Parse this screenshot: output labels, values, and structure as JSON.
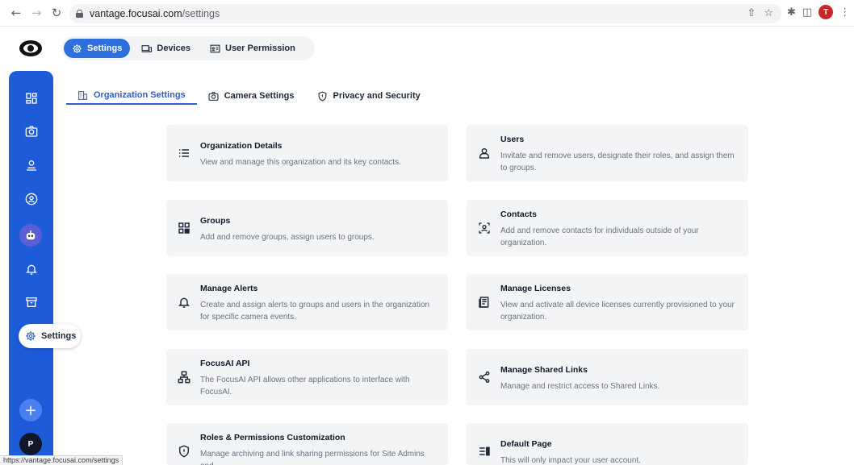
{
  "browser": {
    "url_host": "vantage.focusai.com",
    "url_path": "/settings",
    "profile_initial": "T",
    "status_url": "https://vantage.focusai.com/settings"
  },
  "topnav": {
    "items": [
      {
        "label": "Settings",
        "icon": "gear-icon",
        "active": true
      },
      {
        "label": "Devices",
        "icon": "devices-icon",
        "active": false
      },
      {
        "label": "User Permission",
        "icon": "id-card-icon",
        "active": false
      }
    ]
  },
  "sidebar": {
    "active_label": "Settings",
    "user_initial": "P",
    "icons": [
      "dashboard-icon",
      "camera-icon",
      "person-pin-icon",
      "face-scan-icon",
      "bot-icon",
      "bell-icon",
      "archive-icon",
      "gear-icon"
    ],
    "accent": "#1d5bd8"
  },
  "subtabs": [
    {
      "label": "Organization Settings",
      "icon": "building-icon",
      "active": true
    },
    {
      "label": "Camera Settings",
      "icon": "camera-icon",
      "active": false
    },
    {
      "label": "Privacy and Security",
      "icon": "shield-icon",
      "active": false
    }
  ],
  "cards": [
    {
      "title": "Organization Details",
      "description": "View and manage this organization and its key contacts.",
      "icon": "list-icon"
    },
    {
      "title": "Users",
      "description": "Invitate and remove users, designate their roles, and assign them to groups.",
      "icon": "user-icon"
    },
    {
      "title": "Groups",
      "description": "Add and remove groups, assign users to groups.",
      "icon": "groups-grid-icon"
    },
    {
      "title": "Contacts",
      "description": "Add and remove contacts for individuals outside of your organization.",
      "icon": "contact-icon"
    },
    {
      "title": "Manage Alerts",
      "description": "Create and assign alerts to groups and users in the organization for specific camera events.",
      "icon": "bell-icon"
    },
    {
      "title": "Manage Licenses",
      "description": "View and activate all device licenses currently provisioned to your organization.",
      "icon": "license-icon"
    },
    {
      "title": "FocusAI API",
      "description": "The FocusAI API allows other applications to interface with FocusAI.",
      "icon": "api-icon"
    },
    {
      "title": "Manage Shared Links",
      "description": "Manage and restrict access to Shared Links.",
      "icon": "share-icon"
    },
    {
      "title": "Roles & Permissions Customization",
      "description": "Manage archiving and link sharing permissions for Site Admins and",
      "icon": "shield-icon"
    },
    {
      "title": "Default Page",
      "description": "This will only impact your user account.",
      "icon": "default-page-icon"
    }
  ]
}
